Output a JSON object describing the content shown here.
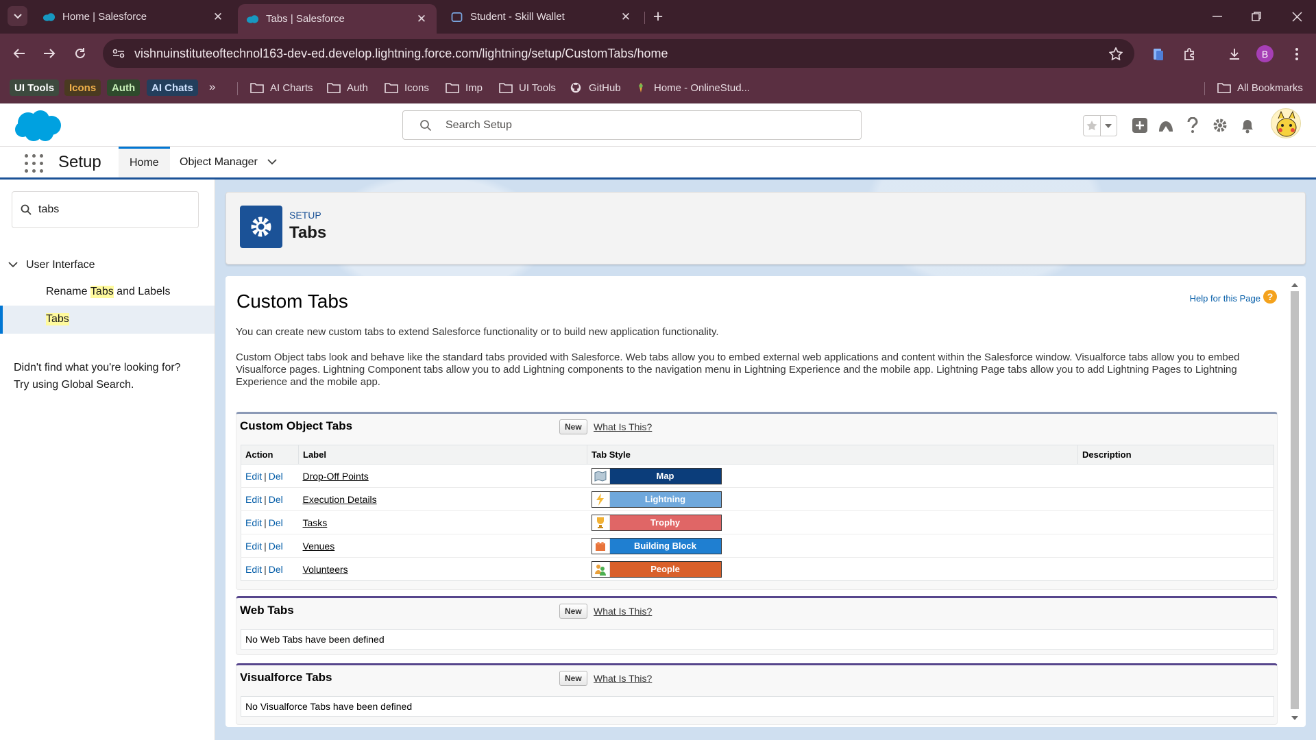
{
  "browser": {
    "tabs": [
      {
        "title": "Home | Salesforce",
        "active": false
      },
      {
        "title": "Tabs | Salesforce",
        "active": true
      },
      {
        "title": "Student - Skill Wallet",
        "active": false
      }
    ],
    "url": "vishnuinstituteoftechnol163-dev-ed.develop.lightning.force.com/lightning/setup/CustomTabs/home",
    "profile_initial": "B",
    "bookmark_chips": [
      {
        "label": "UI Tools",
        "bg": "#3d4a3e",
        "color": "#ffffff"
      },
      {
        "label": "Icons",
        "bg": "#4a3a20",
        "color": "#f0b04a"
      },
      {
        "label": "Auth",
        "bg": "#2f4a2c",
        "color": "#c8f0b8"
      },
      {
        "label": "AI Chats",
        "bg": "#233e5c",
        "color": "#cfe2ff"
      }
    ],
    "bookmark_folders": [
      "AI Charts",
      "Auth",
      "Icons",
      "Imp",
      "UI Tools"
    ],
    "bookmark_github": "GitHub",
    "bookmark_onlinestud": "Home - OnlineStud...",
    "all_bookmarks": "All Bookmarks"
  },
  "sf_header": {
    "search_placeholder": "Search Setup"
  },
  "setup_nav": {
    "title": "Setup",
    "tabs": [
      {
        "label": "Home",
        "active": true
      },
      {
        "label": "Object Manager",
        "active": false
      }
    ]
  },
  "sidebar": {
    "quick_find_value": "tabs",
    "section": "User Interface",
    "rename_prefix": "Rename ",
    "rename_highlight": "Tabs",
    "rename_suffix": " and Labels",
    "selected_item": "Tabs",
    "not_found_line1": "Didn't find what you're looking for?",
    "not_found_line2": "Try using Global Search."
  },
  "page_header": {
    "eyebrow": "SETUP",
    "title": "Tabs"
  },
  "content": {
    "title": "Custom Tabs",
    "help_link": "Help for this Page",
    "help_icon": "?",
    "intro": "You can create new custom tabs to extend Salesforce functionality or to build new application functionality.",
    "details": "Custom Object tabs look and behave like the standard tabs provided with Salesforce. Web tabs allow you to embed external web applications and content within the Salesforce window. Visualforce tabs allow you to embed Visualforce pages. Lightning Component tabs allow you to add Lightning components to the navigation menu in Lightning Experience and the mobile app. Lightning Page tabs allow you to add Lightning Pages to Lightning Experience and the mobile app.",
    "custom_object_tabs": {
      "title": "Custom Object Tabs",
      "new_label": "New",
      "what_label": "What Is This?",
      "columns": [
        "Action",
        "Label",
        "Tab Style",
        "Description"
      ],
      "edit_label": "Edit",
      "del_label": "Del",
      "rows": [
        {
          "label": "Drop-Off Points",
          "style": "Map",
          "color": "#0b3d7a",
          "icon": "map-icon"
        },
        {
          "label": "Execution Details",
          "style": "Lightning",
          "color": "#6fa8dc",
          "icon": "lightning-icon"
        },
        {
          "label": "Tasks",
          "style": "Trophy",
          "color": "#e06666",
          "icon": "trophy-icon"
        },
        {
          "label": "Venues",
          "style": "Building Block",
          "color": "#1f7fd1",
          "icon": "building-block-icon"
        },
        {
          "label": "Volunteers",
          "style": "People",
          "color": "#d9602a",
          "icon": "people-icon"
        }
      ]
    },
    "web_tabs": {
      "title": "Web Tabs",
      "new_label": "New",
      "what_label": "What Is This?",
      "empty": "No Web Tabs have been defined"
    },
    "visualforce_tabs": {
      "title": "Visualforce Tabs",
      "new_label": "New",
      "what_label": "What Is This?",
      "empty": "No Visualforce Tabs have been defined"
    }
  }
}
